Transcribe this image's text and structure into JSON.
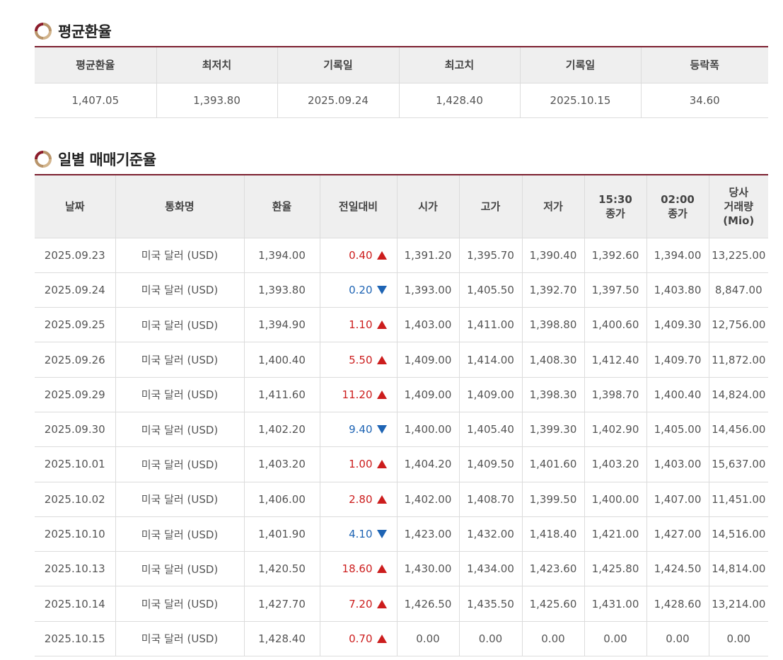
{
  "average_section": {
    "title": "평균환율",
    "headers": [
      "평균환율",
      "최저치",
      "기록일",
      "최고치",
      "기록일",
      "등락폭"
    ],
    "values": [
      "1,407.05",
      "1,393.80",
      "2025.09.24",
      "1,428.40",
      "2025.10.15",
      "34.60"
    ]
  },
  "daily_section": {
    "title": "일별 매매기준율",
    "headers": {
      "date": "날짜",
      "currency": "통화명",
      "rate": "환율",
      "change": "전일대비",
      "open": "시가",
      "high": "고가",
      "low": "저가",
      "close1530_a": "15:30",
      "close1530_b": "종가",
      "close0200_a": "02:00",
      "close0200_b": "종가",
      "volume_a": "당사",
      "volume_b": "거래량",
      "volume_c": "(Mio)"
    },
    "rows": [
      {
        "date": "2025.09.23",
        "currency": "미국 달러 (USD)",
        "rate": "1,394.00",
        "change": "0.40",
        "dir": "up",
        "open": "1,391.20",
        "high": "1,395.70",
        "low": "1,390.40",
        "c1530": "1,392.60",
        "c0200": "1,394.00",
        "volume": "13,225.00"
      },
      {
        "date": "2025.09.24",
        "currency": "미국 달러 (USD)",
        "rate": "1,393.80",
        "change": "0.20",
        "dir": "down",
        "open": "1,393.00",
        "high": "1,405.50",
        "low": "1,392.70",
        "c1530": "1,397.50",
        "c0200": "1,403.80",
        "volume": "8,847.00"
      },
      {
        "date": "2025.09.25",
        "currency": "미국 달러 (USD)",
        "rate": "1,394.90",
        "change": "1.10",
        "dir": "up",
        "open": "1,403.00",
        "high": "1,411.00",
        "low": "1,398.80",
        "c1530": "1,400.60",
        "c0200": "1,409.30",
        "volume": "12,756.00"
      },
      {
        "date": "2025.09.26",
        "currency": "미국 달러 (USD)",
        "rate": "1,400.40",
        "change": "5.50",
        "dir": "up",
        "open": "1,409.00",
        "high": "1,414.00",
        "low": "1,408.30",
        "c1530": "1,412.40",
        "c0200": "1,409.70",
        "volume": "11,872.00"
      },
      {
        "date": "2025.09.29",
        "currency": "미국 달러 (USD)",
        "rate": "1,411.60",
        "change": "11.20",
        "dir": "up",
        "open": "1,409.00",
        "high": "1,409.00",
        "low": "1,398.30",
        "c1530": "1,398.70",
        "c0200": "1,400.40",
        "volume": "14,824.00"
      },
      {
        "date": "2025.09.30",
        "currency": "미국 달러 (USD)",
        "rate": "1,402.20",
        "change": "9.40",
        "dir": "down",
        "open": "1,400.00",
        "high": "1,405.40",
        "low": "1,399.30",
        "c1530": "1,402.90",
        "c0200": "1,405.00",
        "volume": "14,456.00"
      },
      {
        "date": "2025.10.01",
        "currency": "미국 달러 (USD)",
        "rate": "1,403.20",
        "change": "1.00",
        "dir": "up",
        "open": "1,404.20",
        "high": "1,409.50",
        "low": "1,401.60",
        "c1530": "1,403.20",
        "c0200": "1,403.00",
        "volume": "15,637.00"
      },
      {
        "date": "2025.10.02",
        "currency": "미국 달러 (USD)",
        "rate": "1,406.00",
        "change": "2.80",
        "dir": "up",
        "open": "1,402.00",
        "high": "1,408.70",
        "low": "1,399.50",
        "c1530": "1,400.00",
        "c0200": "1,407.00",
        "volume": "11,451.00"
      },
      {
        "date": "2025.10.10",
        "currency": "미국 달러 (USD)",
        "rate": "1,401.90",
        "change": "4.10",
        "dir": "down",
        "open": "1,423.00",
        "high": "1,432.00",
        "low": "1,418.40",
        "c1530": "1,421.00",
        "c0200": "1,427.00",
        "volume": "14,516.00"
      },
      {
        "date": "2025.10.13",
        "currency": "미국 달러 (USD)",
        "rate": "1,420.50",
        "change": "18.60",
        "dir": "up",
        "open": "1,430.00",
        "high": "1,434.00",
        "low": "1,423.60",
        "c1530": "1,425.80",
        "c0200": "1,424.50",
        "volume": "14,814.00"
      },
      {
        "date": "2025.10.14",
        "currency": "미국 달러 (USD)",
        "rate": "1,427.70",
        "change": "7.20",
        "dir": "up",
        "open": "1,426.50",
        "high": "1,435.50",
        "low": "1,425.60",
        "c1530": "1,431.00",
        "c0200": "1,428.60",
        "volume": "13,214.00"
      },
      {
        "date": "2025.10.15",
        "currency": "미국 달러 (USD)",
        "rate": "1,428.40",
        "change": "0.70",
        "dir": "up",
        "open": "0.00",
        "high": "0.00",
        "low": "0.00",
        "c1530": "0.00",
        "c0200": "0.00",
        "volume": "0.00"
      }
    ]
  },
  "colors": {
    "accent": "#7b1e2e",
    "up": "#cc1d1d",
    "down": "#1e64b4",
    "header_bg": "#efefef",
    "icon_brown": "#b8946a",
    "icon_red": "#8c1d2c"
  }
}
